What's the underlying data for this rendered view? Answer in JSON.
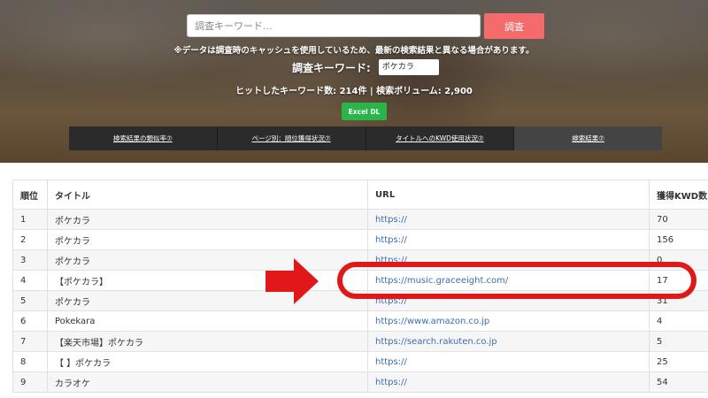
{
  "search": {
    "placeholder": "調査キーワード...",
    "button_label": "調査"
  },
  "notice": "※データは調査時のキャッシュを使用しているため、最新の検索結果と異なる場合があります。",
  "keyword": {
    "label": "調査キーワード:",
    "value": "ポケカラ"
  },
  "stats": "ヒットしたキーワード数: 214件 | 検索ボリューム: 2,900",
  "excel_button": "Excel DL",
  "tabs": [
    {
      "label": "検索結果の類似率⑦"
    },
    {
      "label": "ページ別：順位獲得状況⑦"
    },
    {
      "label": "タイトルへのKWD使用状況⑦"
    },
    {
      "label": "検索結果⑦"
    }
  ],
  "table": {
    "headers": [
      "順位",
      "タイトル",
      "URL",
      "獲得KWD数"
    ],
    "rows": [
      {
        "rank": "1",
        "title": "ポケカラ",
        "url": "https://",
        "kwd": "70"
      },
      {
        "rank": "2",
        "title": "ポケカラ",
        "url": "https://",
        "kwd": "156"
      },
      {
        "rank": "3",
        "title": "ポケカラ",
        "url": "https://",
        "kwd": "0"
      },
      {
        "rank": "4",
        "title": "【ポケカラ】",
        "url": "https://music.graceeight.com/",
        "kwd": "17"
      },
      {
        "rank": "5",
        "title": "ポケカラ",
        "url": "https://",
        "kwd": "31"
      },
      {
        "rank": "6",
        "title": "Pokekara",
        "url": "https://www.amazon.co.jp",
        "kwd": "4"
      },
      {
        "rank": "7",
        "title": "【楽天市場】ポケカラ",
        "url": "https://search.rakuten.co.jp",
        "kwd": "5"
      },
      {
        "rank": "8",
        "title": "【                         】ポケカラ",
        "url": "https://",
        "kwd": "25"
      },
      {
        "rank": "9",
        "title": "カラオケ",
        "url": "https://",
        "kwd": "54"
      }
    ]
  },
  "colors": {
    "search_button": "#f36b6b",
    "excel_button": "#2ab44a",
    "annotation_red": "#e01818",
    "link": "#3b6fb0"
  }
}
